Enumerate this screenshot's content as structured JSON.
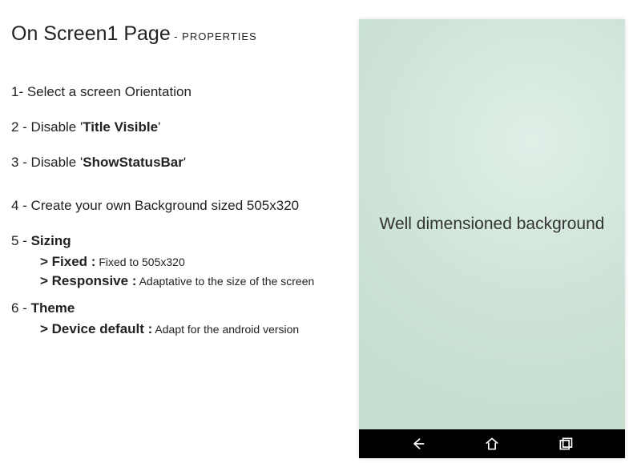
{
  "title": {
    "big": "On Screen1 Page",
    "small": " - PROPERTIES"
  },
  "steps": {
    "s1": "1- Select a screen Orientation",
    "s2_prefix": "2 - Disable '",
    "s2_bold": "Title Visible",
    "s2_suffix": "'",
    "s3_prefix": "3 - Disable '",
    "s3_bold": "ShowStatusBar",
    "s3_suffix": "'",
    "s4": "4 - Create your own Background sized 505x320",
    "s5_prefix": "5 - ",
    "s5_bold": "Sizing",
    "s5a_label": "> Fixed :",
    "s5a_note": " Fixed to 505x320",
    "s5b_label": "> Responsive :",
    "s5b_note": " Adaptative to the size of the screen",
    "s6_prefix": "6 - ",
    "s6_bold": "Theme",
    "s6a_label": "> Device default :",
    "s6a_note": " Adapt for the android version"
  },
  "phone": {
    "caption": "Well dimensioned background"
  }
}
